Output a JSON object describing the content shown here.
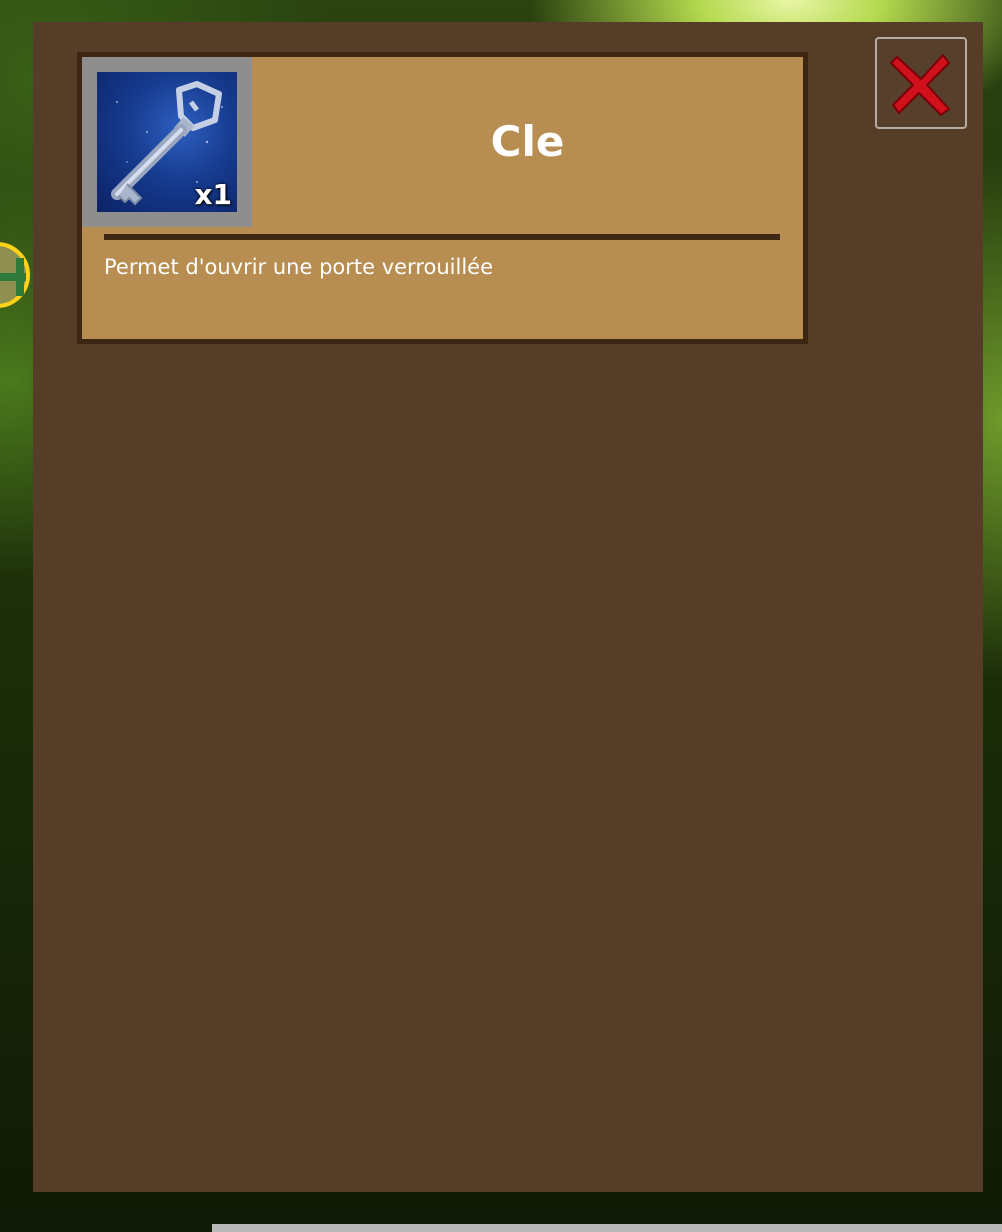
{
  "item": {
    "name": "Cle",
    "quantity": "x1",
    "description": "Permet d'ouvrir une porte verrouillée",
    "icon": "key-icon"
  },
  "close_button": {
    "icon": "close-icon",
    "color": "#d0101a"
  },
  "background": {
    "side_button_icon": "plus-icon"
  },
  "colors": {
    "modal_background": "#553d27",
    "card_background": "#b88d51",
    "card_border": "#3e2712",
    "icon_frame": "#8e8e8e"
  }
}
